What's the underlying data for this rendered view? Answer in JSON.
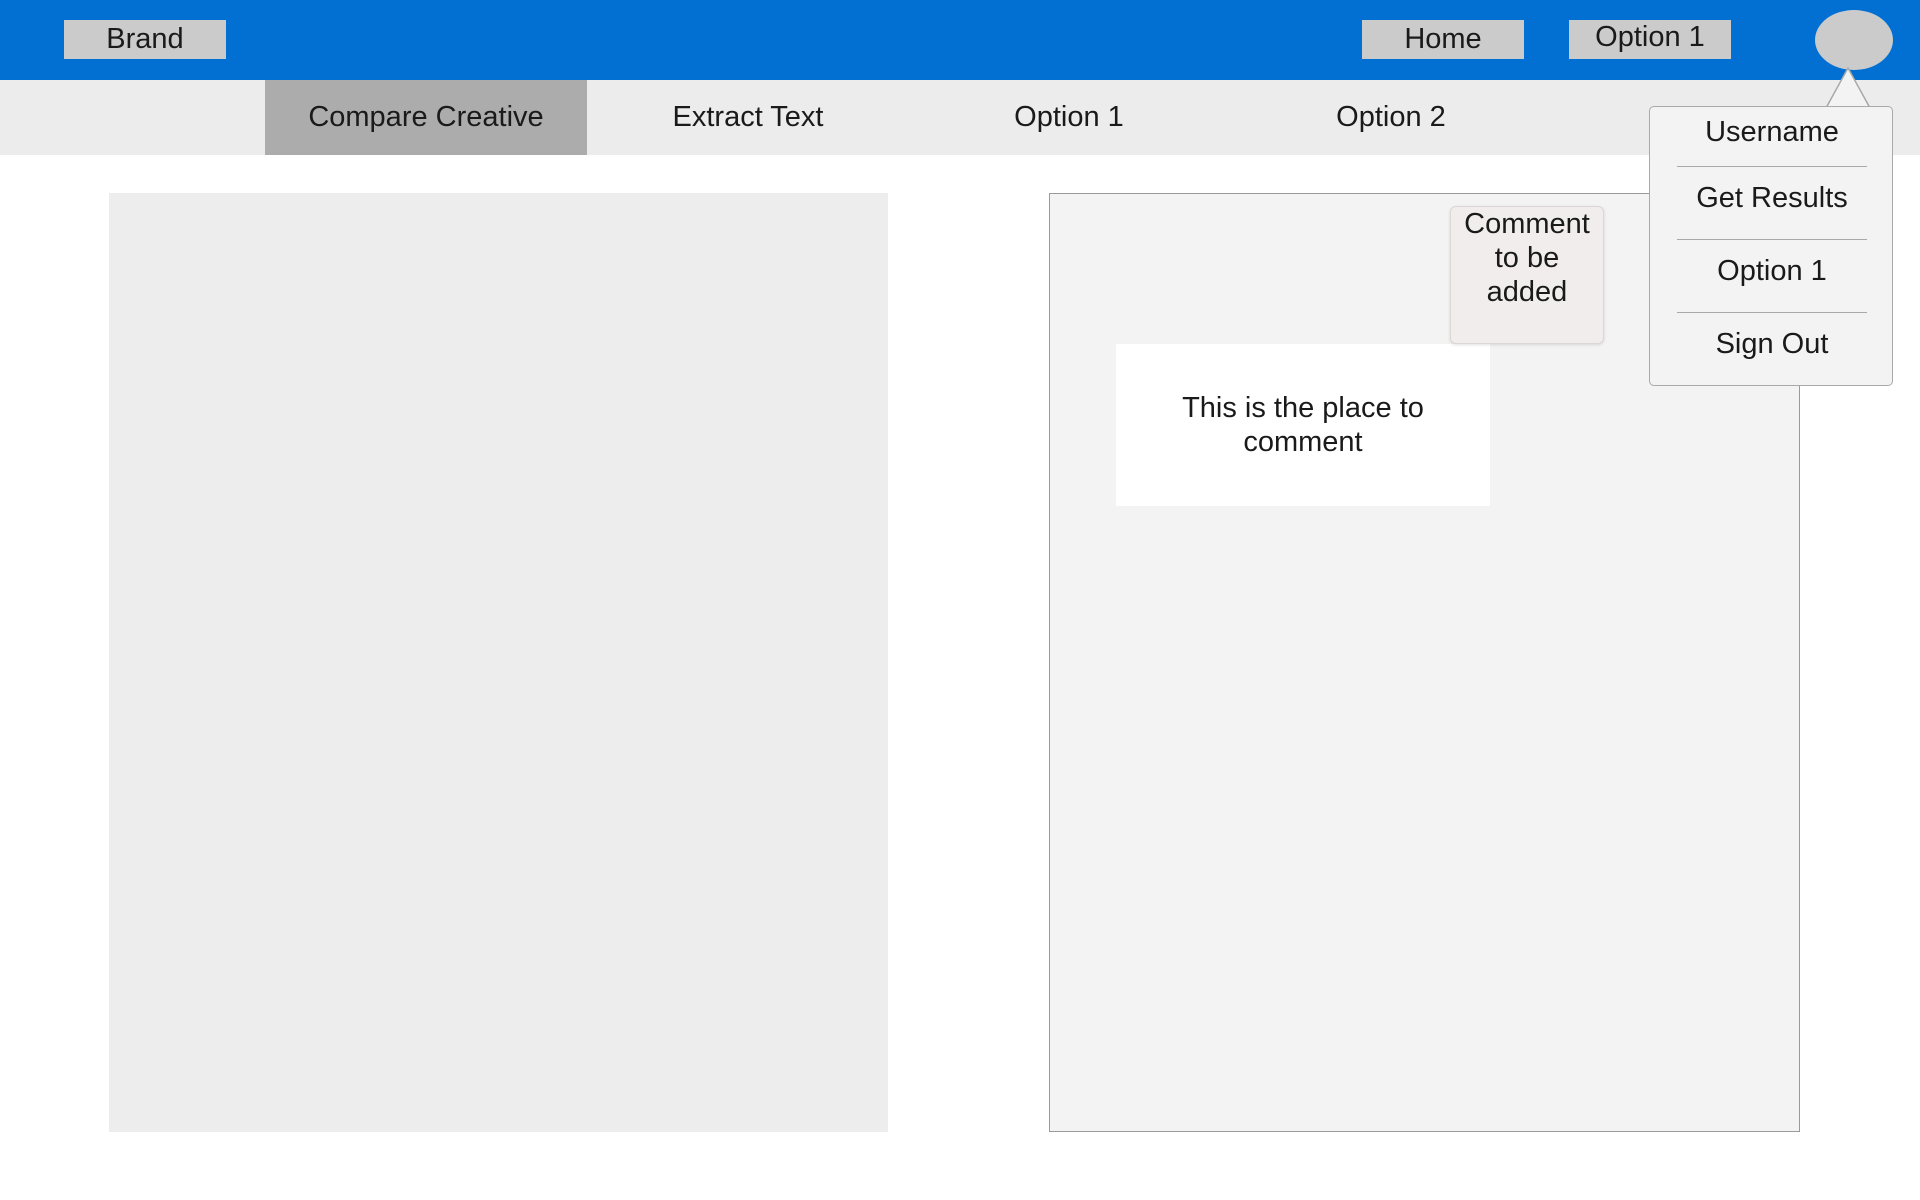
{
  "topbar": {
    "brand_label": "Brand",
    "home_label": "Home",
    "option1_label": "Option 1",
    "background_color": "#0170d2"
  },
  "subnav": {
    "tabs": [
      {
        "label": "Compare Creative",
        "active": true
      },
      {
        "label": "Extract Text",
        "active": false
      },
      {
        "label": "Option 1",
        "active": false
      },
      {
        "label": "Option 2",
        "active": false
      }
    ]
  },
  "comment": {
    "box_text": "This is the place to comment",
    "note_lines": [
      "Comment",
      "to be",
      "added"
    ]
  },
  "user_menu": {
    "items": [
      {
        "label": "Username"
      },
      {
        "label": "Get Results"
      },
      {
        "label": "Option 1"
      },
      {
        "label": "Sign Out"
      }
    ]
  }
}
